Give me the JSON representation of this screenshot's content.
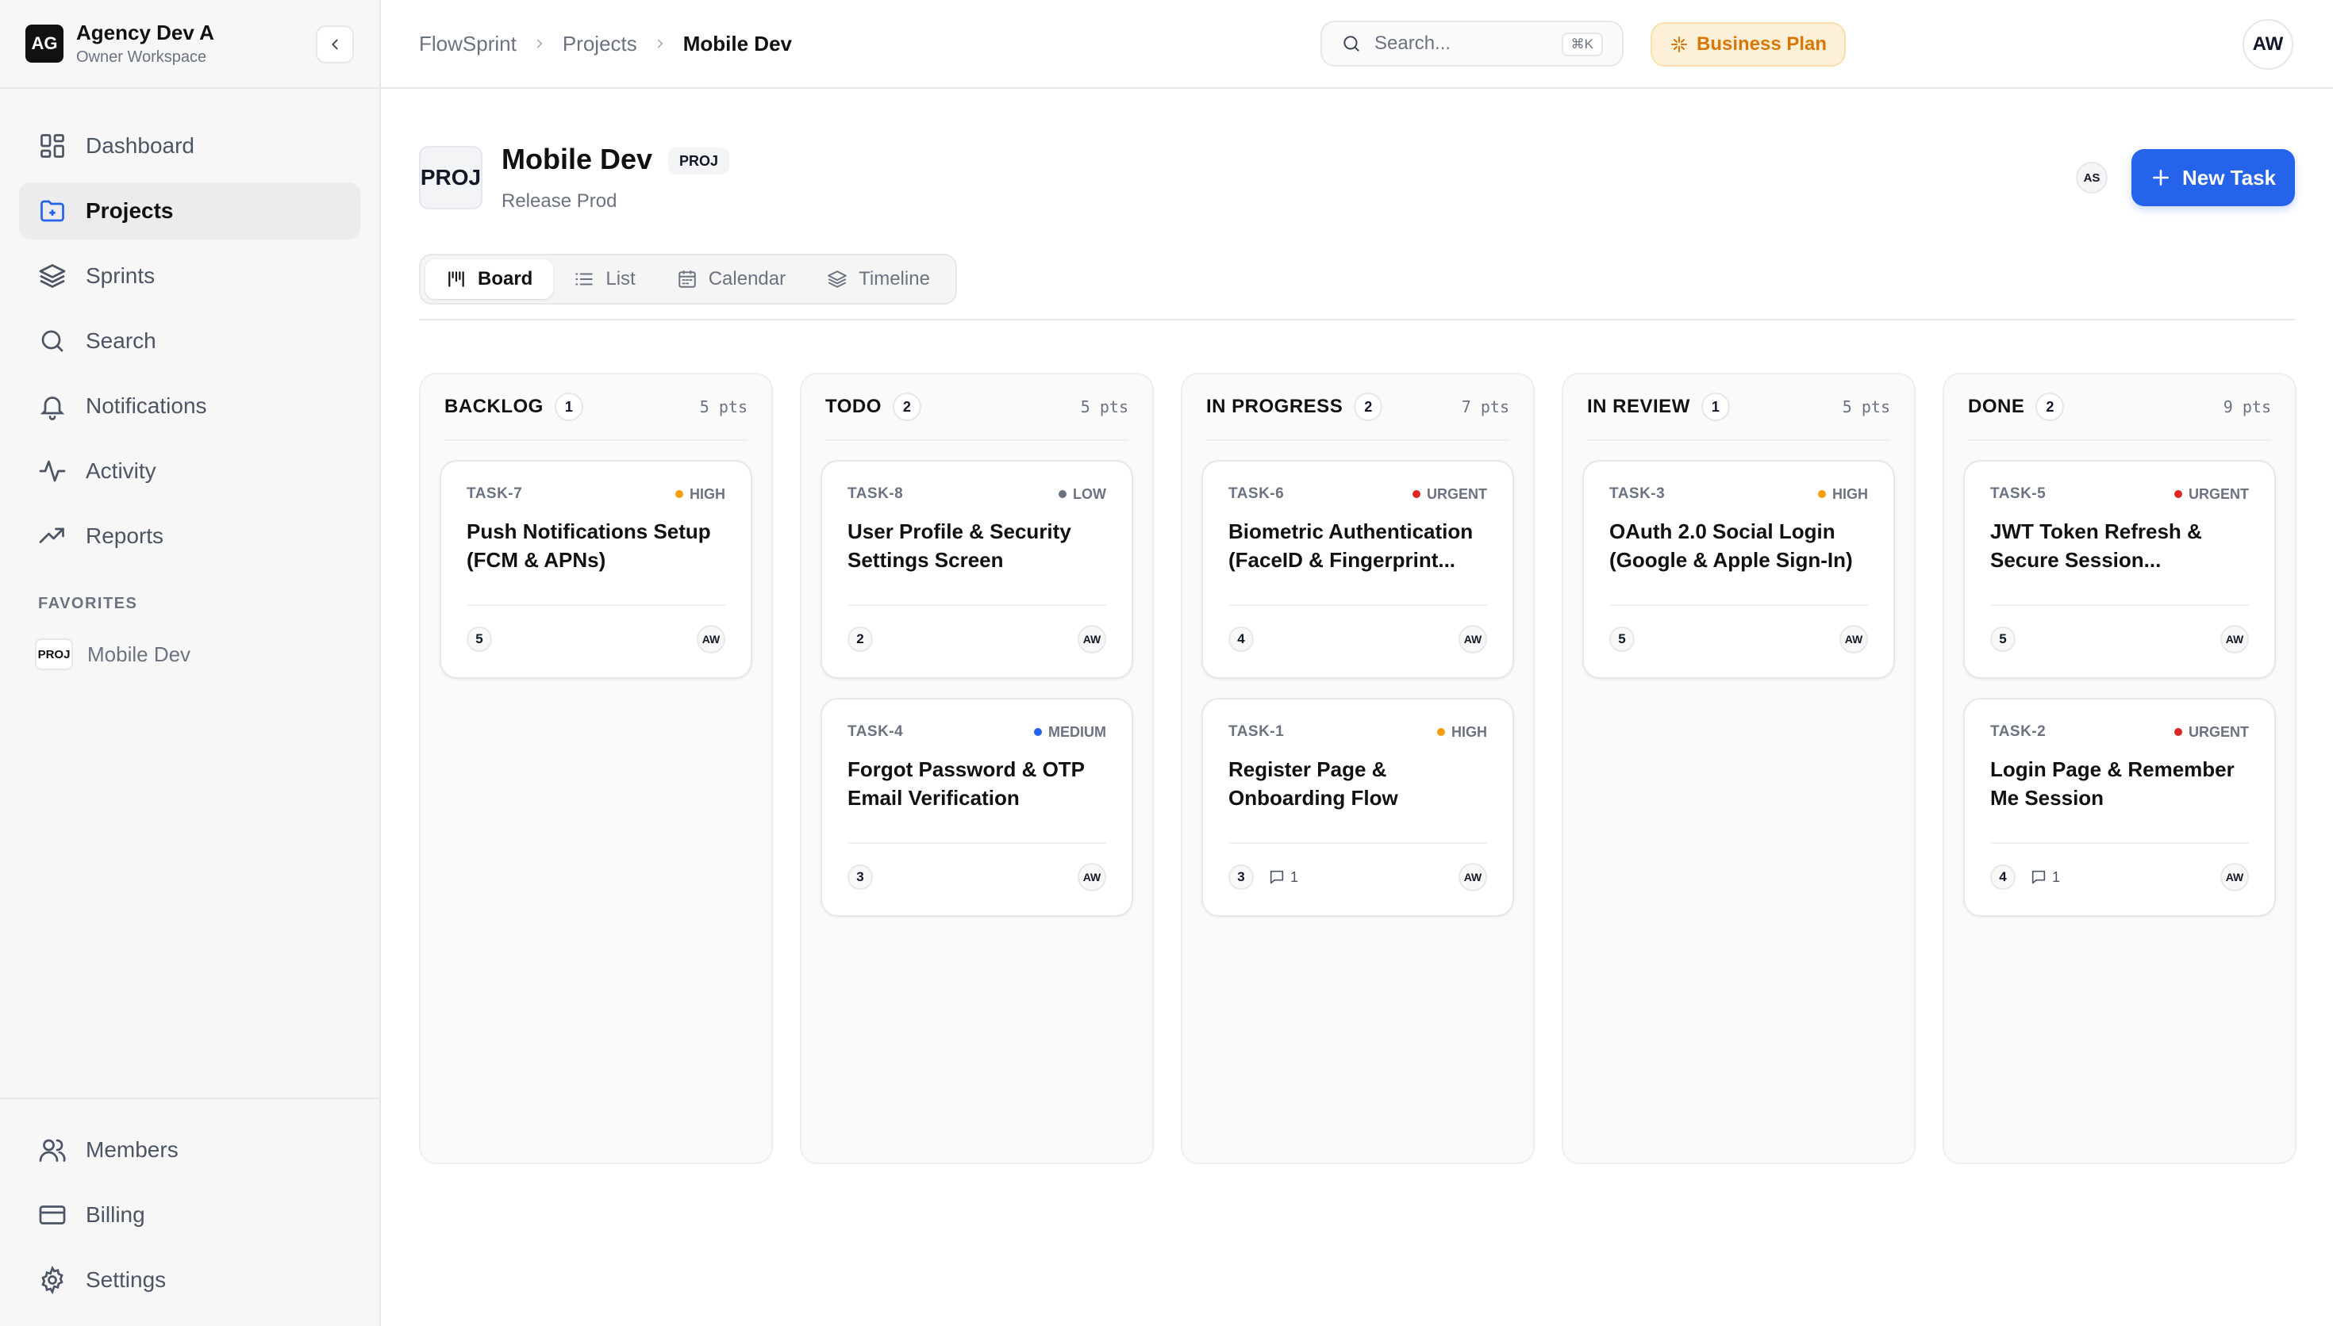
{
  "workspace": {
    "logo": "AG",
    "name": "Agency Dev A",
    "subtitle": "Owner Workspace"
  },
  "nav": {
    "items": [
      {
        "label": "Dashboard",
        "icon": "dashboard-icon",
        "active": false
      },
      {
        "label": "Projects",
        "icon": "folder-icon",
        "active": true
      },
      {
        "label": "Sprints",
        "icon": "layers-icon",
        "active": false
      },
      {
        "label": "Search",
        "icon": "search-icon",
        "active": false
      },
      {
        "label": "Notifications",
        "icon": "bell-icon",
        "active": false
      },
      {
        "label": "Activity",
        "icon": "activity-icon",
        "active": false
      },
      {
        "label": "Reports",
        "icon": "trending-icon",
        "active": false
      }
    ],
    "favorites_label": "FAVORITES",
    "favorites": [
      {
        "badge": "PROJ",
        "label": "Mobile Dev"
      }
    ],
    "bottom": [
      {
        "label": "Members",
        "icon": "users-icon"
      },
      {
        "label": "Billing",
        "icon": "credit-card-icon"
      },
      {
        "label": "Settings",
        "icon": "gear-icon"
      }
    ]
  },
  "breadcrumb": [
    "FlowSprint",
    "Projects",
    "Mobile Dev"
  ],
  "search": {
    "placeholder": "Search...",
    "shortcut": "⌘K"
  },
  "plan": {
    "label": "Business Plan",
    "color": "#d97706"
  },
  "user": {
    "initials": "AW"
  },
  "project": {
    "icon": "PROJ",
    "title": "Mobile Dev",
    "key": "PROJ",
    "subtitle": "Release Prod",
    "member": "AS",
    "new_task_label": "New Task"
  },
  "views": [
    {
      "label": "Board",
      "icon": "board-icon",
      "active": true
    },
    {
      "label": "List",
      "icon": "list-icon",
      "active": false
    },
    {
      "label": "Calendar",
      "icon": "calendar-icon",
      "active": false
    },
    {
      "label": "Timeline",
      "icon": "layers-icon",
      "active": false
    }
  ],
  "priority_colors": {
    "HIGH": "#f59e0b",
    "LOW": "#6b7280",
    "URGENT": "#dc2626",
    "MEDIUM": "#2563eb"
  },
  "columns": [
    {
      "title": "BACKLOG",
      "count": "1",
      "points": "5 pts",
      "cards": [
        {
          "id": "TASK-7",
          "priority": "HIGH",
          "title": "Push Notifications Setup (FCM & APNs)",
          "points": "5",
          "comments": "",
          "assignee": "AW"
        }
      ]
    },
    {
      "title": "TODO",
      "count": "2",
      "points": "5 pts",
      "cards": [
        {
          "id": "TASK-8",
          "priority": "LOW",
          "title": "User Profile & Security Settings Screen",
          "points": "2",
          "comments": "",
          "assignee": "AW"
        },
        {
          "id": "TASK-4",
          "priority": "MEDIUM",
          "title": "Forgot Password & OTP Email Verification",
          "points": "3",
          "comments": "",
          "assignee": "AW"
        }
      ]
    },
    {
      "title": "IN PROGRESS",
      "count": "2",
      "points": "7 pts",
      "cards": [
        {
          "id": "TASK-6",
          "priority": "URGENT",
          "title": "Biometric Authentication (FaceID & Fingerprint...",
          "points": "4",
          "comments": "",
          "assignee": "AW"
        },
        {
          "id": "TASK-1",
          "priority": "HIGH",
          "title": "Register Page & Onboarding Flow",
          "points": "3",
          "comments": "1",
          "assignee": "AW"
        }
      ]
    },
    {
      "title": "IN REVIEW",
      "count": "1",
      "points": "5 pts",
      "cards": [
        {
          "id": "TASK-3",
          "priority": "HIGH",
          "title": "OAuth 2.0 Social Login (Google & Apple Sign-In)",
          "points": "5",
          "comments": "",
          "assignee": "AW"
        }
      ]
    },
    {
      "title": "DONE",
      "count": "2",
      "points": "9 pts",
      "cards": [
        {
          "id": "TASK-5",
          "priority": "URGENT",
          "title": "JWT Token Refresh & Secure Session...",
          "points": "5",
          "comments": "",
          "assignee": "AW"
        },
        {
          "id": "TASK-2",
          "priority": "URGENT",
          "title": "Login Page & Remember Me Session",
          "points": "4",
          "comments": "1",
          "assignee": "AW"
        }
      ]
    }
  ]
}
